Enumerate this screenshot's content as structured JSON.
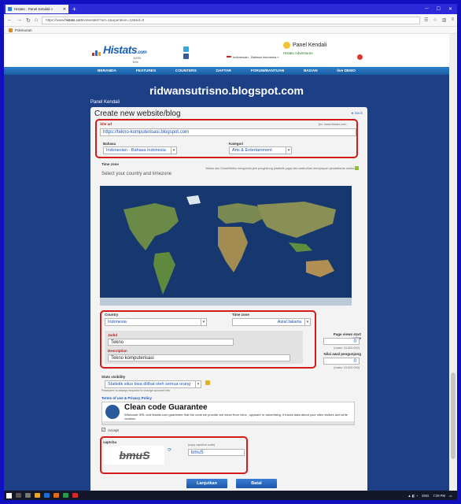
{
  "browser": {
    "tab_title": "Histats - Panel Kendali »",
    "url_prefix": "https://www.",
    "url_domain": "histats.com",
    "url_rest": "/viewstats/?act=1&operation=12&sid=0",
    "bookmark": "Pokmunan"
  },
  "site": {
    "logo_main": "Histats",
    "logo_com": ".com",
    "logo_free": "100% free",
    "panel_title": "Panel Kendali",
    "language_label": "Indonesian - Bahasa Indonesia »",
    "adventures_label": "Histats Adventures",
    "menu": [
      "BERANDA",
      "FEATURES",
      "COUNTERS",
      "DAFTAR",
      "FORUM/BANTUAN",
      "BAGAN",
      "live DEMO"
    ]
  },
  "watermark": "ridwansutrisno.blogspot.com",
  "breadcrumb": "Panel Kendali",
  "form": {
    "title": "Create new website/blog",
    "back_label": "Back",
    "site_url_label": "Site url",
    "site_url_hint": "[ex: www.histats.com",
    "site_url_value": "https://tekno-komputerisasi.blogspot.com",
    "bahasa_label": "Bahasa",
    "bahasa_value": "Indonesian - Bahasa Indonesia",
    "kategori_label": "Kategori",
    "kategori_value": "Arts & Entertainment",
    "timezone_label": "Time zone",
    "timezone_note": "Waktu dan Zona/Waktu mengubah jam penghitung (statistik juga) dan waktu/hari menyimpan pendaftaran waktu:",
    "select_country_title": "Select your country and timezone",
    "country_label": "Country",
    "country_value": "Indonesia",
    "timezone2_label": "Time zone",
    "timezone2_value": "Asia/Jakarta",
    "judul_label": "Judul",
    "judul_value": "Tekno",
    "description_label": "Description",
    "description_value": "Tekno komputerisasi",
    "page_views_label": "Page views start value",
    "page_views_value": "0",
    "page_views_hint": "(maks: 15.000.000)",
    "visits_label": "Nilai awal pengunjung",
    "visits_value": "0",
    "visits_hint": "(maks: 15.000.000)",
    "visibility_label": "Stats visibility",
    "visibility_value": "Statistik situs bisa dilihat oleh semua orang",
    "password_note": "Password is always required to change account info",
    "terms_label": "Terms of use & Privacy Policy",
    "terms_heading": "Clean code Guarantee",
    "terms_text": "Wisecode SRL and histats.com guarantee that the code we provide are clean from virus , spyware or advertising. it tracks data about your sites visitors and write cookies.",
    "accept_label": "Accept",
    "captcha_label": "captcha",
    "captcha_image_text": "bmuS",
    "captcha_hint": "(copy captcha code)",
    "captcha_value": "bmuS",
    "submit_label": "Lanjutkan",
    "cancel_label": "Batal"
  },
  "taskbar": {
    "lang": "ENG",
    "time": "7:29 PM"
  },
  "colors": {
    "accent": "#1a5ea3",
    "highlight_box": "#d41a1a",
    "page_bg": "#1c3f86"
  }
}
